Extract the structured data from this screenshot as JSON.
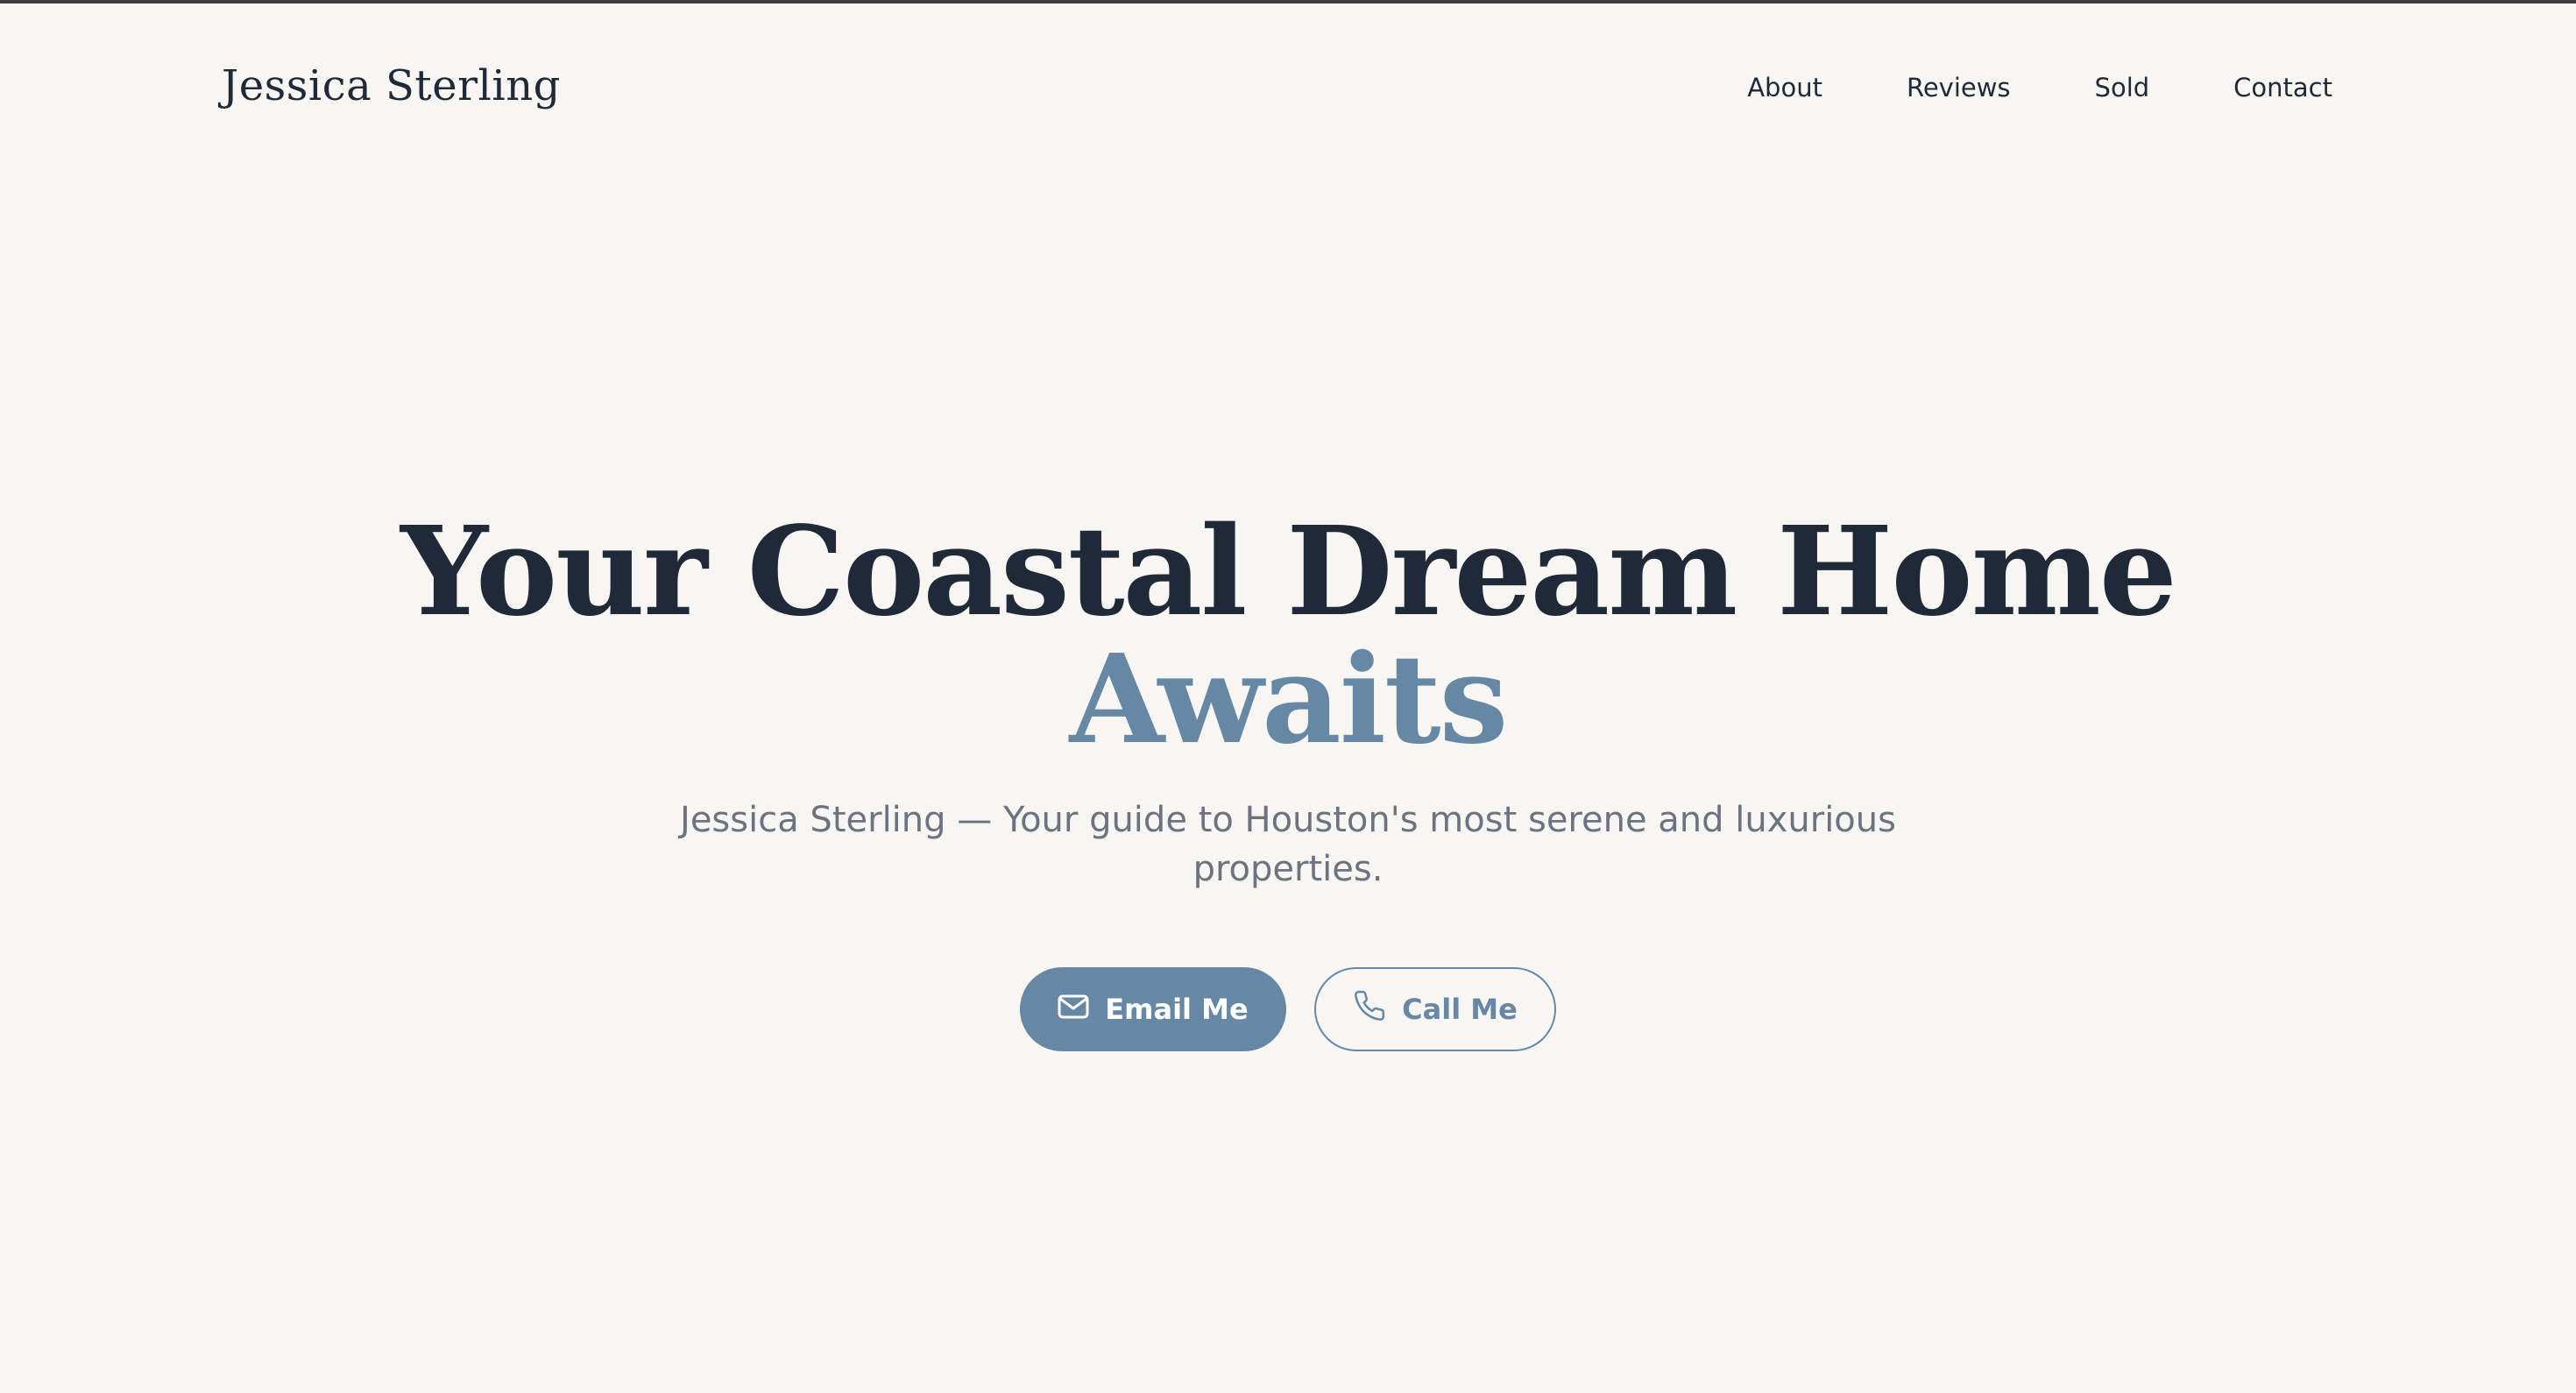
{
  "header": {
    "brand": "Jessica Sterling",
    "nav": [
      {
        "label": "About"
      },
      {
        "label": "Reviews"
      },
      {
        "label": "Sold"
      },
      {
        "label": "Contact"
      }
    ]
  },
  "hero": {
    "title_line1": "Your Coastal Dream Home",
    "title_line2": "Awaits",
    "subtitle": "Jessica Sterling — Your guide to Houston's most serene and luxurious properties.",
    "buttons": {
      "email": {
        "label": "Email Me",
        "icon": "mail-icon"
      },
      "call": {
        "label": "Call Me",
        "icon": "phone-icon"
      }
    }
  },
  "colors": {
    "background": "#f8f6f3",
    "heading": "#1f2937",
    "accent": "#6688a5",
    "muted_text": "#6b7280"
  }
}
